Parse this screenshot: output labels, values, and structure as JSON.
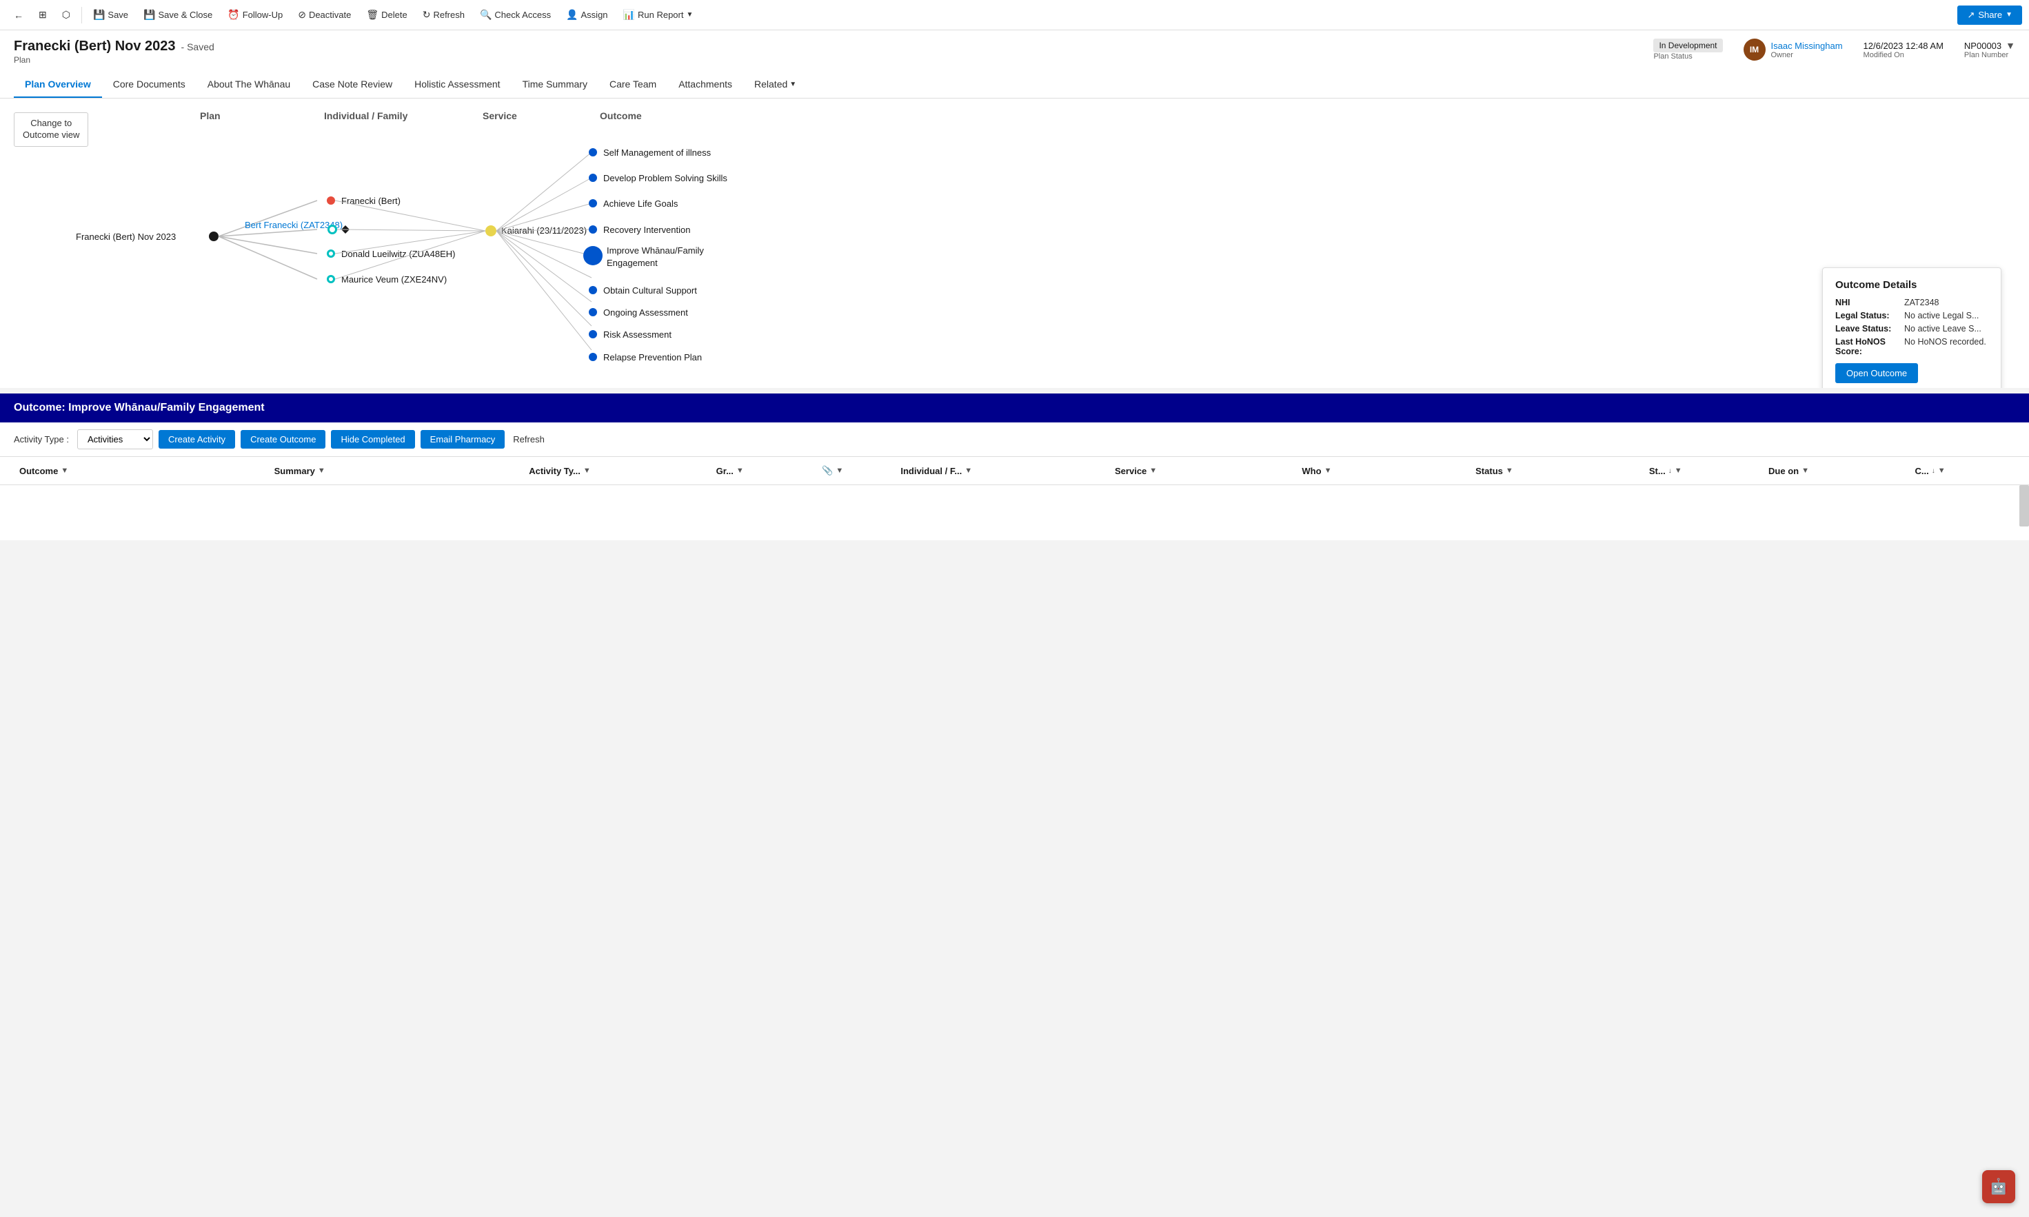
{
  "toolbar": {
    "back_icon": "←",
    "list_icon": "☰",
    "popout_icon": "⬜",
    "save_label": "Save",
    "save_close_label": "Save & Close",
    "follow_up_label": "Follow-Up",
    "deactivate_label": "Deactivate",
    "delete_label": "Delete",
    "refresh_label": "Refresh",
    "check_access_label": "Check Access",
    "assign_label": "Assign",
    "run_report_label": "Run Report",
    "share_label": "Share"
  },
  "record": {
    "title": "Franecki (Bert) Nov 2023",
    "saved_label": "- Saved",
    "type": "Plan",
    "plan_status": "In Development",
    "plan_status_label": "Plan Status",
    "owner_name": "Isaac Missingham",
    "owner_label": "Owner",
    "owner_initials": "IM",
    "modified_on": "12/6/2023 12:48 AM",
    "modified_label": "Modified On",
    "plan_number": "NP00003",
    "plan_number_label": "Plan Number"
  },
  "nav": {
    "tabs": [
      {
        "id": "plan-overview",
        "label": "Plan Overview",
        "active": true
      },
      {
        "id": "core-documents",
        "label": "Core Documents",
        "active": false
      },
      {
        "id": "about-whanau",
        "label": "About The Whānau",
        "active": false
      },
      {
        "id": "case-note-review",
        "label": "Case Note Review",
        "active": false
      },
      {
        "id": "holistic-assessment",
        "label": "Holistic Assessment",
        "active": false
      },
      {
        "id": "time-summary",
        "label": "Time Summary",
        "active": false
      },
      {
        "id": "care-team",
        "label": "Care Team",
        "active": false
      },
      {
        "id": "attachments",
        "label": "Attachments",
        "active": false
      },
      {
        "id": "related",
        "label": "Related",
        "active": false
      }
    ]
  },
  "diagram": {
    "change_view_btn": "Change to\nOutcome view",
    "columns": {
      "plan": "Plan",
      "individual_family": "Individual / Family",
      "service": "Service",
      "outcome": "Outcome"
    },
    "nodes": {
      "plan_node": "Franecki (Bert) Nov 2023",
      "service_node": "Kaiarahi (23/11/2023)",
      "link_node": "Bert Franecki (ZAT2348)",
      "individuals": [
        "Franecki (Bert)",
        "Bert Franecki (ZAT2348)",
        "Donald Lueilwitz (ZUA48EH)",
        "Maurice Veum (ZXE24NV)"
      ],
      "outcomes": [
        "Self Management of illness",
        "Develop Problem Solving Skills",
        "Achieve Life Goals",
        "Recovery Intervention",
        "Improve Whānau/Family Engagement",
        "Obtain Cultural Support",
        "Ongoing Assessment",
        "Risk Assessment",
        "Relapse Prevention Plan"
      ]
    }
  },
  "outcome_popup": {
    "title": "Outcome Details",
    "nhi_label": "NHI",
    "nhi_value": "ZAT2348",
    "legal_status_label": "Legal Status:",
    "legal_status_value": "No active Legal S...",
    "leave_status_label": "Leave Status:",
    "leave_status_value": "No active Leave S...",
    "honos_label": "Last HoNOS Score:",
    "honos_value": "No HoNOS recorded.",
    "open_btn": "Open Outcome"
  },
  "activity_section": {
    "header": "Outcome: Improve Whānau/Family Engagement",
    "type_label": "Activity Type :",
    "type_value": "Activities",
    "create_activity_btn": "Create Activity",
    "create_outcome_btn": "Create Outcome",
    "hide_completed_btn": "Hide Completed",
    "email_pharmacy_btn": "Email Pharmacy",
    "refresh_btn": "Refresh",
    "table_columns": [
      {
        "id": "outcome",
        "label": "Outcome"
      },
      {
        "id": "summary",
        "label": "Summary"
      },
      {
        "id": "activity_type",
        "label": "Activity Ty..."
      },
      {
        "id": "gr",
        "label": "Gr..."
      },
      {
        "id": "attach",
        "label": ""
      },
      {
        "id": "individual",
        "label": "Individual / F..."
      },
      {
        "id": "service",
        "label": "Service"
      },
      {
        "id": "who",
        "label": "Who"
      },
      {
        "id": "status",
        "label": "Status"
      },
      {
        "id": "st",
        "label": "St..."
      },
      {
        "id": "due_on",
        "label": "Due on"
      },
      {
        "id": "c",
        "label": "C..."
      }
    ]
  }
}
